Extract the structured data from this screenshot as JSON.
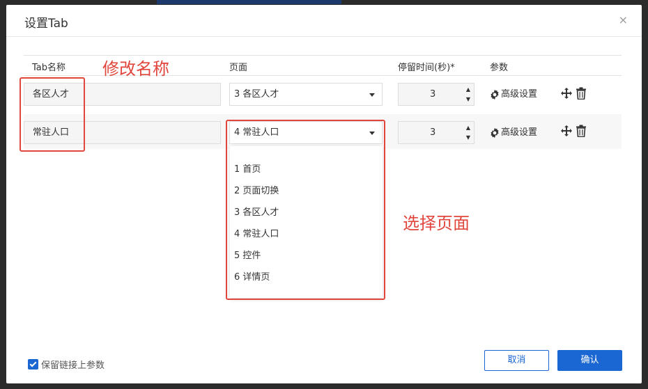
{
  "dialog": {
    "title": "设置Tab",
    "close_label": "×"
  },
  "table": {
    "headers": {
      "name": "Tab名称",
      "page": "页面",
      "duration": "停留时间(秒)*",
      "params": "参数"
    },
    "rows": [
      {
        "name": "各区人才",
        "page": "3 各区人才",
        "duration": "3",
        "advanced": "高级设置"
      },
      {
        "name": "常驻人口",
        "page": "4 常驻人口",
        "duration": "3",
        "advanced": "高级设置"
      }
    ]
  },
  "dropdown": {
    "options": [
      "1 首页",
      "2 页面切换",
      "3 各区人才",
      "4 常驻人口",
      "5 控件",
      "6 详情页"
    ]
  },
  "annotations": {
    "rename": "修改名称",
    "select_page": "选择页面",
    "color": "#e0463c"
  },
  "footer": {
    "keep_params_label": "保留链接上参数",
    "keep_params_checked": true,
    "cancel_label": "取消",
    "confirm_label": "确认"
  },
  "colors": {
    "primary": "#1a66d2"
  }
}
